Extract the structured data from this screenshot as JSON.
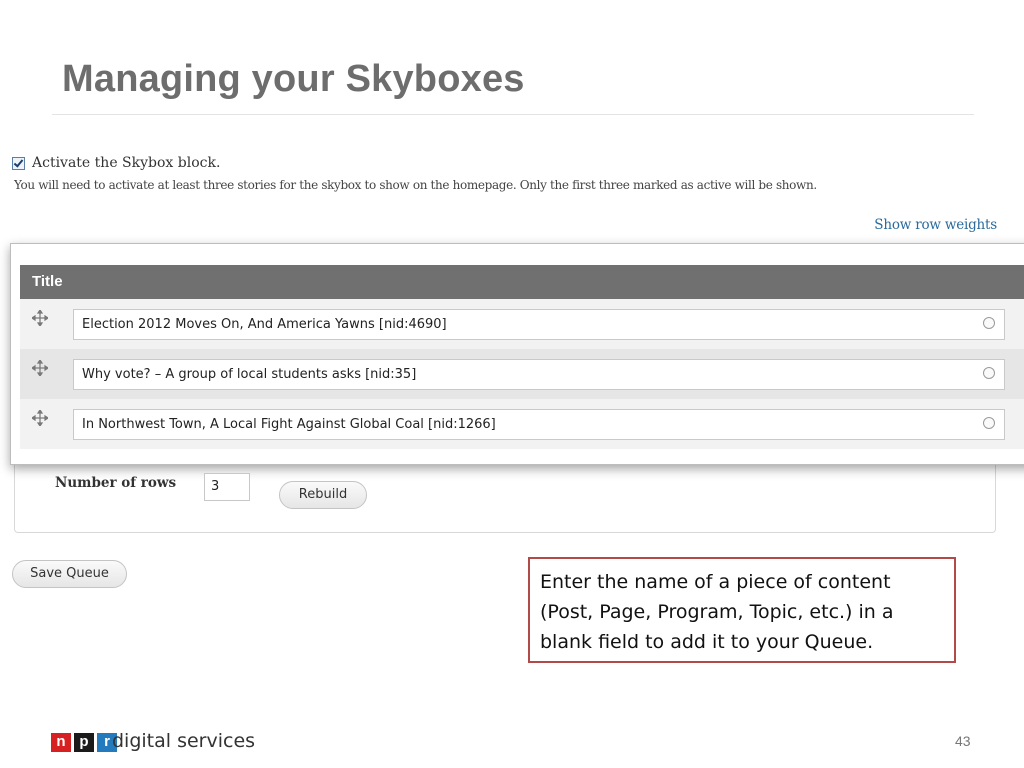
{
  "slide": {
    "title": "Managing your Skyboxes",
    "page_number": "43"
  },
  "form": {
    "activate_checked": true,
    "activate_label": "Activate the Skybox block.",
    "help_text": "You will need to activate at least three stories for the skybox to show on the homepage. Only the first three marked as active will be shown.",
    "show_row_weights": "Show row weights",
    "table": {
      "header": "Title",
      "rows": [
        {
          "value": "Election 2012 Moves On, And America Yawns [nid:4690]"
        },
        {
          "value": "Why vote? – A group of local students asks [nid:35]"
        },
        {
          "value": "In Northwest Town, A Local Fight Against Global Coal [nid:1266]"
        }
      ]
    },
    "number_of_rows_label": "Number of rows",
    "number_of_rows_value": "3",
    "rebuild_label": "Rebuild",
    "save_label": "Save Queue"
  },
  "callout": {
    "text": "Enter the name of a piece of content (Post, Page, Program, Topic, etc.) in a blank field to add it to your Queue."
  },
  "footer": {
    "logo_letters": [
      "n",
      "p",
      "r"
    ],
    "brand_text": "digital services"
  },
  "colors": {
    "title": "#6d6d6d",
    "table_header": "#707070",
    "link": "#2a6a9c",
    "callout_border": "#b24a4a",
    "npr_red": "#d62021",
    "npr_black": "#1a1a1a",
    "npr_blue": "#237bbd"
  },
  "icons": {
    "drag_handle": "move-arrows-icon",
    "autocomplete": "throbber-circle-icon",
    "checkbox": "checkmark-icon"
  }
}
